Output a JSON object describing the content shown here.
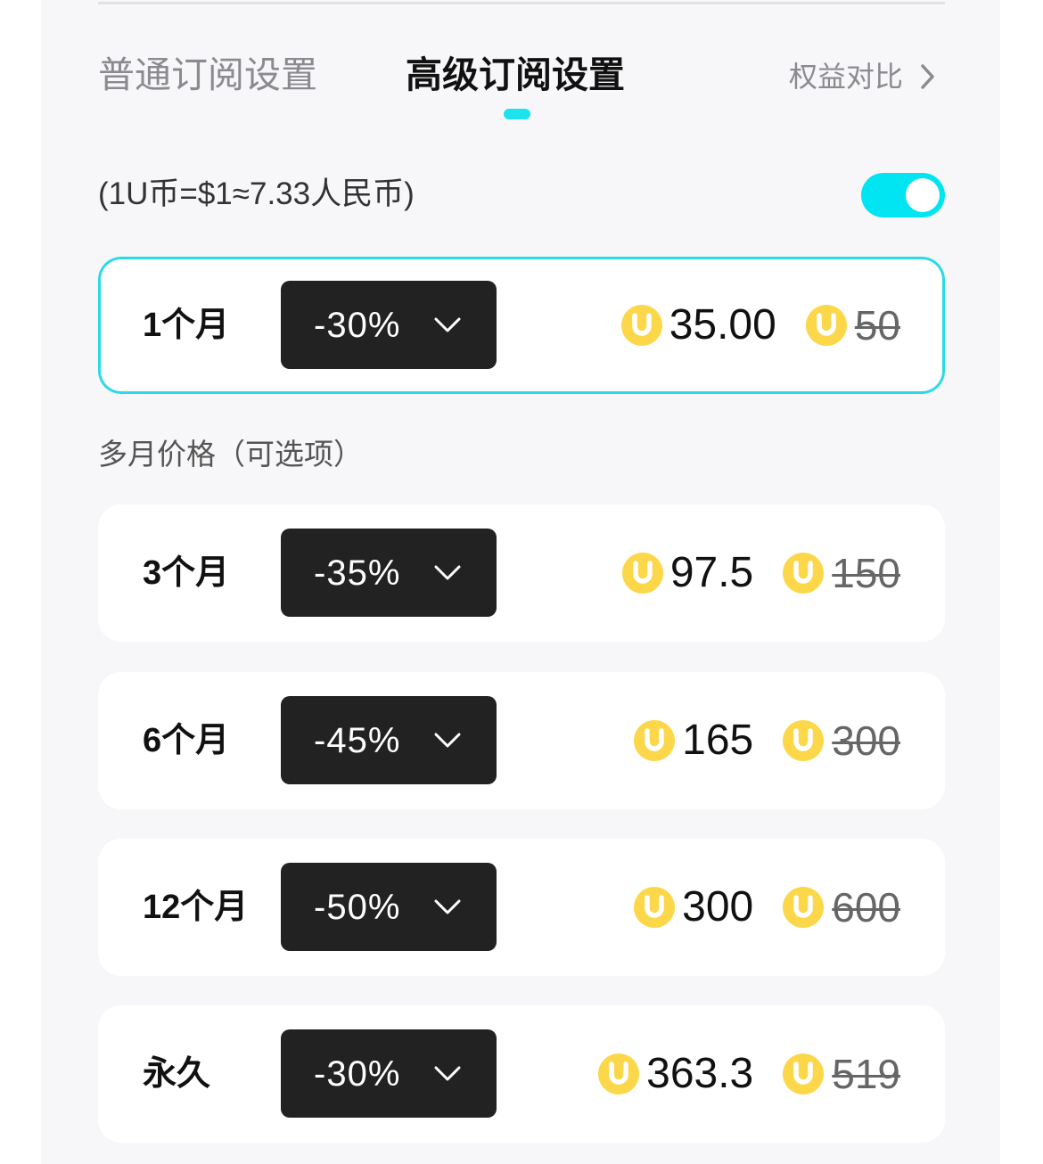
{
  "tabs": {
    "normal": {
      "label": "普通订阅设置",
      "active": false
    },
    "premium": {
      "label": "高级订阅设置",
      "active": true
    }
  },
  "compare_link": {
    "label": "权益对比",
    "icon": "chevron-right-icon"
  },
  "exchange_rate": "(1U币=$1≈7.33人民币)",
  "toggle": {
    "on": true
  },
  "single_month": {
    "period": "1个月",
    "discount": "-30%",
    "price": "35.00",
    "original_price": "50",
    "selected": true
  },
  "multi_month": {
    "label": "多月价格（可选项）",
    "plans": [
      {
        "period": "3个月",
        "discount": "-35%",
        "price": "97.5",
        "original_price": "150"
      },
      {
        "period": "6个月",
        "discount": "-45%",
        "price": "165",
        "original_price": "300"
      },
      {
        "period": "12个月",
        "discount": "-50%",
        "price": "300",
        "original_price": "600"
      },
      {
        "period": "永久",
        "discount": "-30%",
        "price": "363.3",
        "original_price": "519"
      }
    ]
  },
  "icons": {
    "coin": "u-coin-icon",
    "dropdown": "chevron-down-icon",
    "compare": "chevron-right-icon"
  },
  "colors": {
    "accent": "#1de3ec",
    "toggle_on": "#00e5f1",
    "coin": "#fcd74a",
    "dropdown_bg": "#222222",
    "panel_bg": "#f7f7f9"
  }
}
